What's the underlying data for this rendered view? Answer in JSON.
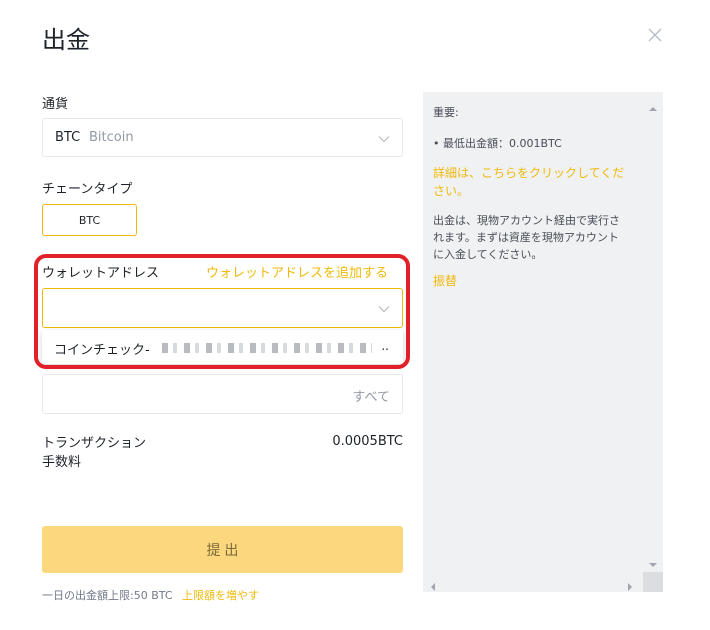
{
  "dialog": {
    "title": "出金",
    "close_icon": "close-icon"
  },
  "currency": {
    "label": "通貨",
    "code": "BTC",
    "name": "Bitcoin"
  },
  "chain": {
    "label": "チェーンタイプ",
    "selected": "BTC"
  },
  "wallet": {
    "label": "ウォレットアドレス",
    "add_link": "ウォレットアドレスを追加する",
    "value": "",
    "dropdown_option": "コインチェック-",
    "dropdown_suffix": ".."
  },
  "amount": {
    "value": "",
    "all_label": "すべて"
  },
  "fee": {
    "label_line1": "トランザクション",
    "label_line2": "手数料",
    "value": "0.0005BTC"
  },
  "submit_label": "提 出",
  "limit": {
    "text": "一日の出金額上限:50 BTC",
    "link": "上限額を増やす"
  },
  "side_panel": {
    "heading": "重要:",
    "min_amount": "• 最低出金額：0.001BTC",
    "detail_link": "詳細は、こちらをクリックしてください。",
    "note": "出金は、現物アカウント経由で実行されます。まずは資産を現物アカウントに入金してください。",
    "swap_link": "振替"
  },
  "colors": {
    "accent": "#f0b90b",
    "submit_bg": "#fcd77e",
    "highlight": "#e2202a",
    "side_bg": "#f0f1f2"
  }
}
